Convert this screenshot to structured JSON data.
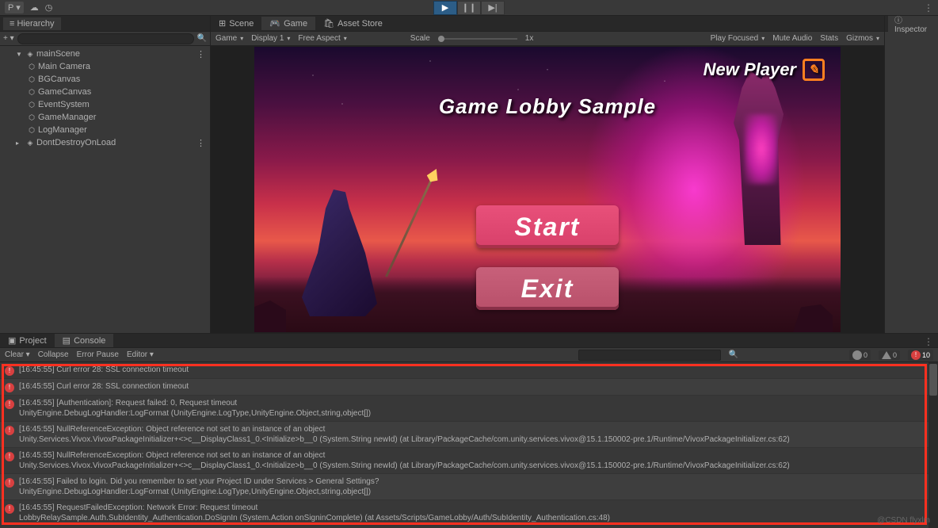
{
  "toolbar": {
    "account_menu": "P ▾"
  },
  "play_controls": {
    "play": "▶",
    "pause": "❙❙",
    "step": "▶|"
  },
  "hierarchy": {
    "title": "Hierarchy",
    "create_label": "+ ▾",
    "items": [
      {
        "label": "mainScene",
        "indent": 1,
        "expanded": true,
        "icon": "unity"
      },
      {
        "label": "Main Camera",
        "indent": 2
      },
      {
        "label": "BGCanvas",
        "indent": 2
      },
      {
        "label": "GameCanvas",
        "indent": 2
      },
      {
        "label": "EventSystem",
        "indent": 2
      },
      {
        "label": "GameManager",
        "indent": 2
      },
      {
        "label": "LogManager",
        "indent": 2
      },
      {
        "label": "DontDestroyOnLoad",
        "indent": 1,
        "icon": "unity"
      }
    ]
  },
  "center_tabs": {
    "scene": "Scene",
    "game": "Game",
    "asset_store": "Asset Store"
  },
  "game_toolbar": {
    "mode": "Game",
    "display": "Display 1",
    "aspect": "Free Aspect",
    "scale_label": "Scale",
    "scale_value": "1x",
    "play_focused": "Play Focused",
    "mute": "Mute Audio",
    "stats": "Stats",
    "gizmos": "Gizmos"
  },
  "game": {
    "title": "Game Lobby Sample",
    "new_player": "New Player",
    "start": "Start",
    "exit": "Exit"
  },
  "inspector": {
    "title": "Inspector"
  },
  "bottom_tabs": {
    "project": "Project",
    "console": "Console"
  },
  "console_toolbar": {
    "clear": "Clear  ▾",
    "collapse": "Collapse",
    "error_pause": "Error Pause",
    "editor": "Editor ▾",
    "info_count": "0",
    "warn_count": "0",
    "error_count": "10"
  },
  "console_entries": [
    {
      "t": "[16:45:55] Curl error 28: SSL connection timeout"
    },
    {
      "t": "[16:45:55] Curl error 28: SSL connection timeout"
    },
    {
      "t": "[16:45:55] [Authentication]: Request failed: 0, Request timeout\nUnityEngine.DebugLogHandler:LogFormat (UnityEngine.LogType,UnityEngine.Object,string,object[])"
    },
    {
      "t": "[16:45:55] NullReferenceException: Object reference not set to an instance of an object\nUnity.Services.Vivox.VivoxPackageInitializer+<>c__DisplayClass1_0.<Initialize>b__0 (System.String newId) (at Library/PackageCache/com.unity.services.vivox@15.1.150002-pre.1/Runtime/VivoxPackageInitializer.cs:62)"
    },
    {
      "t": "[16:45:55] NullReferenceException: Object reference not set to an instance of an object\nUnity.Services.Vivox.VivoxPackageInitializer+<>c__DisplayClass1_0.<Initialize>b__0 (System.String newId) (at Library/PackageCache/com.unity.services.vivox@15.1.150002-pre.1/Runtime/VivoxPackageInitializer.cs:62)"
    },
    {
      "t": "[16:45:55] Failed to login. Did you remember to set your Project ID under Services > General Settings?\nUnityEngine.DebugLogHandler:LogFormat (UnityEngine.LogType,UnityEngine.Object,string,object[])"
    },
    {
      "t": "[16:45:55] RequestFailedException: Network Error: Request timeout\nLobbyRelaySample.Auth.SubIdentity_Authentication.DoSignIn (System.Action onSigninComplete) (at Assets/Scripts/GameLobby/Auth/SubIdentity_Authentication.cs:48)"
    }
  ],
  "watermark": "@CSDN flyxlm"
}
